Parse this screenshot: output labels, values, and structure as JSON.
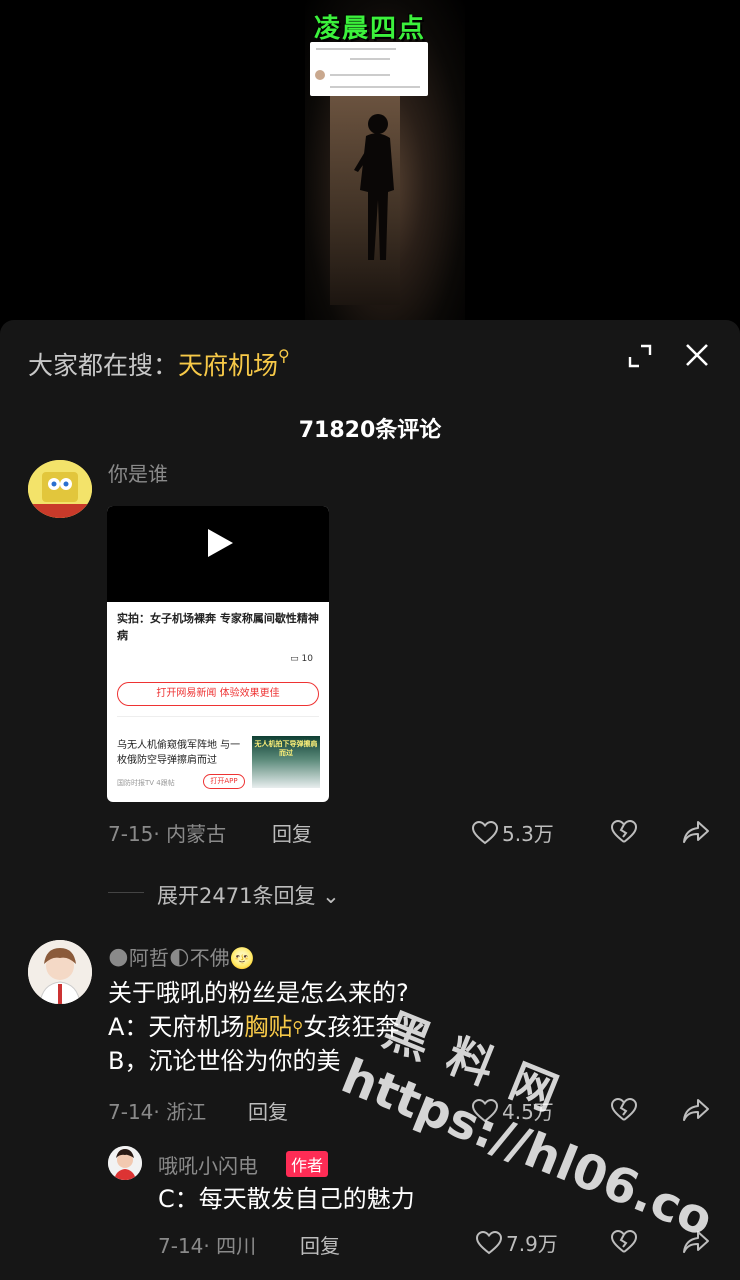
{
  "video": {
    "title_overlay": "凌晨四点"
  },
  "header": {
    "search_prefix": "大家都在搜：",
    "search_keyword": "天府机场",
    "comment_count_title": "71820条评论"
  },
  "comments": [
    {
      "username": "你是谁",
      "attachment": {
        "headline": "实拍：女子机场裸奔 专家称属间歇性精神病",
        "comment_count": "10",
        "open_button": "打开网易新闻 体验效果更佳",
        "related_title": "乌无人机偷窥俄军阵地 与一枚俄防空导弹擦肩而过",
        "related_source": "国防时报TV  4跟帖",
        "related_button": "打开APP",
        "related_thumb_text": "无人机拍下导弹擦肩而过"
      },
      "date_location": "7-15· 内蒙古",
      "reply_label": "回复",
      "likes": "5.3万",
      "expand_replies": "展开2471条回复"
    },
    {
      "username": "阿哲",
      "username_suffix": "不佛",
      "lines": {
        "l1": "关于哦吼的粉丝是怎么来的?",
        "l2a": "A：天府机场",
        "l2b": "胸贴",
        "l2c": "女孩狂奔",
        "l3": "B，沉论世俗为你的美"
      },
      "date_location": "7-14· 浙江",
      "reply_label": "回复",
      "likes": "4.5万"
    },
    {
      "username": "哦吼小闪电",
      "badge": "作者",
      "text": "C：每天散发自己的魅力",
      "date_location": "7-14· 四川",
      "reply_label": "回复",
      "likes": "7.9万"
    }
  ],
  "watermark": {
    "cn": "黑料网",
    "url": "https://hl06.co"
  },
  "colors": {
    "sheet_bg": "#161616",
    "keyword": "#f7c948",
    "author_badge": "#fe2c55",
    "title_green": "#3cf23c"
  }
}
